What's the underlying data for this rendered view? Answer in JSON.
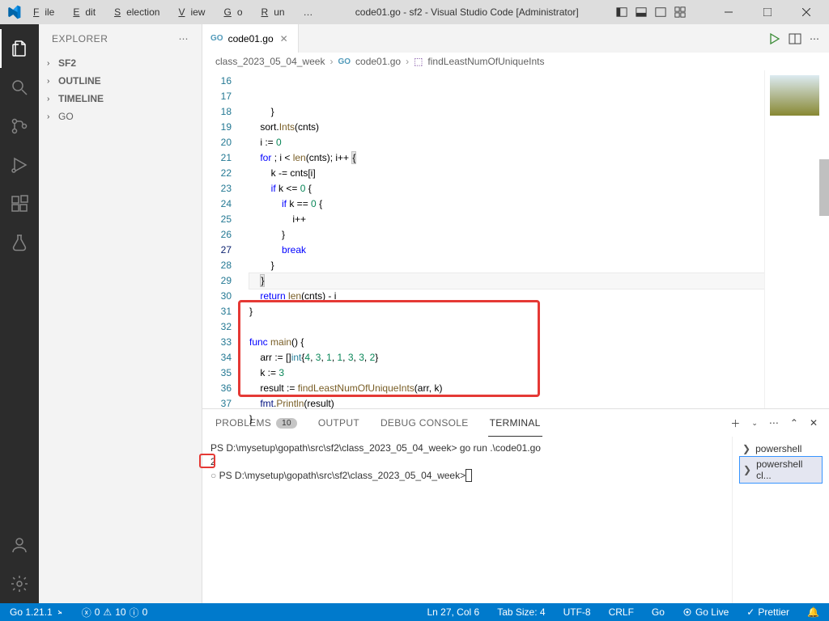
{
  "window": {
    "title": "code01.go - sf2 - Visual Studio Code [Administrator]"
  },
  "menu": [
    "File",
    "Edit",
    "Selection",
    "View",
    "Go",
    "Run",
    "…"
  ],
  "menu_underline": [
    "F",
    "E",
    "S",
    "V",
    "G",
    "R",
    ""
  ],
  "sidebar": {
    "title": "EXPLORER",
    "items": [
      {
        "label": "SF2",
        "bold": true
      },
      {
        "label": "OUTLINE",
        "bold": true
      },
      {
        "label": "TIMELINE",
        "bold": true
      },
      {
        "label": "GO",
        "bold": false
      }
    ]
  },
  "tab": {
    "name": "code01.go"
  },
  "breadcrumb": {
    "folder": "class_2023_05_04_week",
    "file": "code01.go",
    "symbol": "findLeastNumOfUniqueInts"
  },
  "editor": {
    "start": 16,
    "cursor_line": 27,
    "lines": [
      {
        "n": 16,
        "html": "        }"
      },
      {
        "n": 17,
        "html": "    sort.<span class='fn'>Ints</span>(cnts)"
      },
      {
        "n": 18,
        "html": "    i <span class='op'>:=</span> <span class='num'>0</span>"
      },
      {
        "n": 19,
        "html": "    <span class='kw'>for</span> ; i &lt; <span class='fn'>len</span>(cnts); i++ <span class='hlbrace'>{</span>"
      },
      {
        "n": 20,
        "html": "        k -= cnts[i]"
      },
      {
        "n": 21,
        "html": "        <span class='kw'>if</span> k &lt;= <span class='num'>0</span> {"
      },
      {
        "n": 22,
        "html": "            <span class='kw'>if</span> k == <span class='num'>0</span> {"
      },
      {
        "n": 23,
        "html": "                i++"
      },
      {
        "n": 24,
        "html": "            }"
      },
      {
        "n": 25,
        "html": "            <span class='kw'>break</span>"
      },
      {
        "n": 26,
        "html": "        }"
      },
      {
        "n": 27,
        "html": "    <span class='hlbrace'>}</span>"
      },
      {
        "n": 28,
        "html": "    <span class='kw'>return</span> <span class='fn'>len</span>(cnts) - i"
      },
      {
        "n": 29,
        "html": "}"
      },
      {
        "n": 30,
        "html": ""
      },
      {
        "n": 31,
        "html": "<span class='kw'>func</span> <span class='fn'>main</span>() {"
      },
      {
        "n": 32,
        "html": "    arr <span class='op'>:=</span> []<span class='typ'>int</span>{<span class='num'>4</span>, <span class='num'>3</span>, <span class='num'>1</span>, <span class='num'>1</span>, <span class='num'>3</span>, <span class='num'>3</span>, <span class='num'>2</span>}"
      },
      {
        "n": 33,
        "html": "    k <span class='op'>:=</span> <span class='num'>3</span>"
      },
      {
        "n": 34,
        "html": "    result <span class='op'>:=</span> <span class='fn'>findLeastNumOfUniqueInts</span>(arr, k)"
      },
      {
        "n": 35,
        "html": "    <span class='pkg'>fmt</span>.<span class='fn'>Println</span>(result)"
      },
      {
        "n": 36,
        "html": "}"
      },
      {
        "n": 37,
        "html": ""
      }
    ]
  },
  "panel": {
    "tabs": {
      "problems": "PROBLEMS",
      "problems_count": "10",
      "output": "OUTPUT",
      "debug": "DEBUG CONSOLE",
      "terminal": "TERMINAL"
    },
    "terminal": {
      "line1": "PS D:\\mysetup\\gopath\\src\\sf2\\class_2023_05_04_week> go run .\\code01.go",
      "line2": "2",
      "line3": "PS D:\\mysetup\\gopath\\src\\sf2\\class_2023_05_04_week> "
    },
    "side": [
      {
        "label": "powershell"
      },
      {
        "label": "powershell cl...",
        "active": true
      }
    ]
  },
  "status": {
    "go": "Go 1.21.1",
    "errors": "0",
    "warnings": "10",
    "info": "0",
    "ln": "Ln 27, Col 6",
    "tab": "Tab Size: 4",
    "enc": "UTF-8",
    "eol": "CRLF",
    "lang": "Go",
    "golive": "Go Live",
    "prettier": "Prettier",
    "bell": ""
  }
}
